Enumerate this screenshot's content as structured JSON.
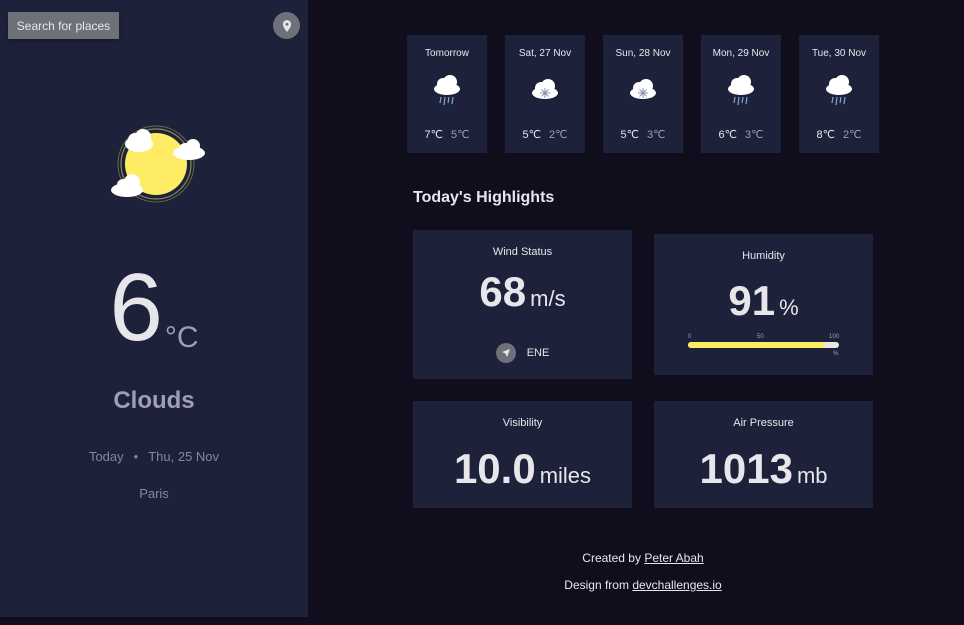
{
  "sidebar": {
    "search_label": "Search for places",
    "location_icon": "location-icon",
    "current": {
      "temp": "6",
      "unit": "°C",
      "condition": "Clouds",
      "today": "Today",
      "separator": "•",
      "date": "Thu, 25 Nov",
      "city": "Paris",
      "icon": "sun-cloud-icon"
    }
  },
  "forecast": [
    {
      "day": "Tomorrow",
      "icon": "rain-icon",
      "max": "7℃",
      "min": "5℃"
    },
    {
      "day": "Sat, 27 Nov",
      "icon": "snow-icon",
      "max": "5℃",
      "min": "2℃"
    },
    {
      "day": "Sun, 28 Nov",
      "icon": "snow-icon",
      "max": "5℃",
      "min": "3℃"
    },
    {
      "day": "Mon, 29 Nov",
      "icon": "rain-icon",
      "max": "6℃",
      "min": "3℃"
    },
    {
      "day": "Tue, 30 Nov",
      "icon": "rain-icon",
      "max": "8℃",
      "min": "2℃"
    }
  ],
  "highlights": {
    "title": "Today's Highlights",
    "wind": {
      "label": "Wind Status",
      "value": "68",
      "unit": "m/s",
      "direction": "ENE"
    },
    "humidity": {
      "label": "Humidity",
      "value": "91",
      "unit": "%",
      "scale": [
        "0",
        "50",
        "100"
      ],
      "scale_unit": "%",
      "level": 0.91
    },
    "visibility": {
      "label": "Visibility",
      "value": "10.0",
      "unit": "miles"
    },
    "pressure": {
      "label": "Air Pressure",
      "value": "1013",
      "unit": "mb"
    }
  },
  "footer": {
    "created_prefix": "Created by",
    "author": "Peter Abah",
    "design_prefix": "Design from",
    "design_site": "devchallenges.io"
  },
  "colors": {
    "sidebar_bg": "#1e213a",
    "page_bg": "#100e1d",
    "accent_yellow": "#ffec65",
    "muted": "#a09fb1"
  }
}
